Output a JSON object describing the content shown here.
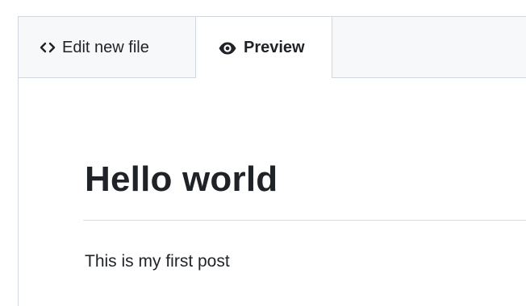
{
  "tabs": {
    "edit": {
      "label": "Edit new file",
      "icon": "code-icon"
    },
    "preview": {
      "label": "Preview",
      "icon": "eye-icon"
    }
  },
  "preview": {
    "heading": "Hello world",
    "paragraph": "This is my first post"
  }
}
